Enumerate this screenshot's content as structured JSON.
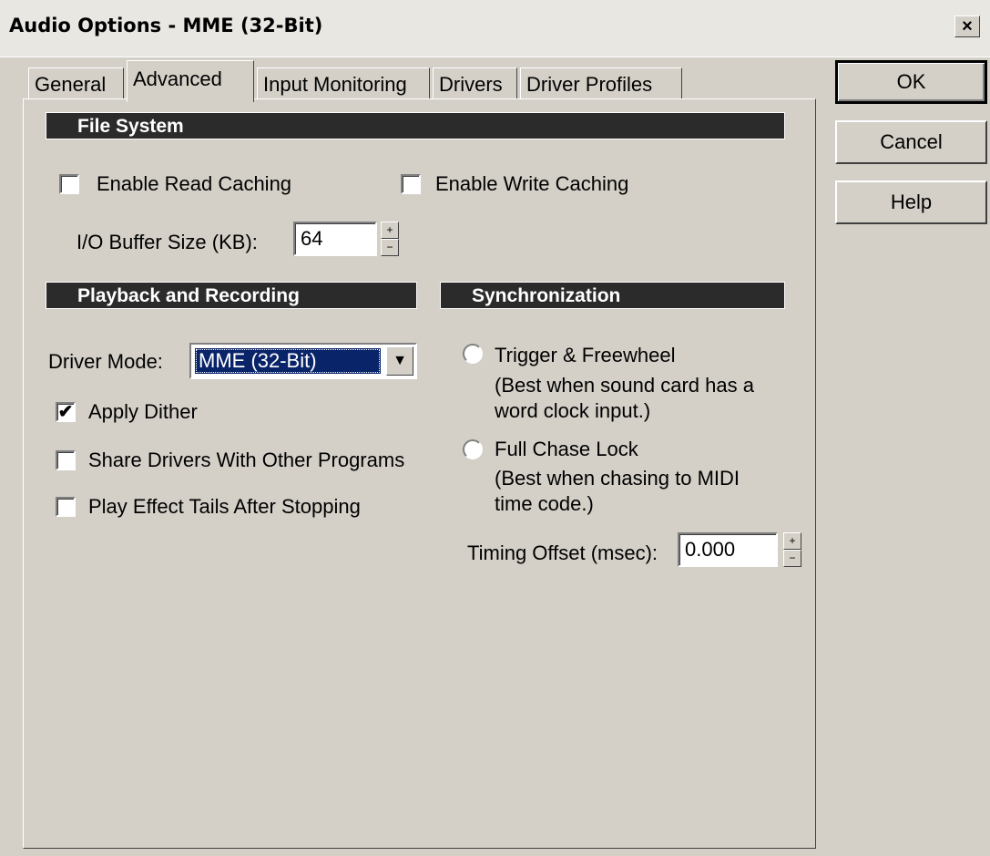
{
  "window": {
    "title": "Audio Options - MME (32-Bit)",
    "close_glyph": "×"
  },
  "tabs": [
    {
      "label": "General",
      "active": false
    },
    {
      "label": "Advanced",
      "active": true
    },
    {
      "label": "Input Monitoring",
      "active": false
    },
    {
      "label": "Drivers",
      "active": false
    },
    {
      "label": "Driver Profiles",
      "active": false
    }
  ],
  "file_system": {
    "heading": "File System",
    "read_caching": {
      "label": "Enable Read Caching",
      "checked": false
    },
    "write_caching": {
      "label": "Enable Write Caching",
      "checked": false
    },
    "buffer": {
      "label": "I/O Buffer Size (KB):",
      "value": "64"
    }
  },
  "playback": {
    "heading": "Playback and Recording",
    "driver_mode": {
      "label": "Driver Mode:",
      "value": "MME (32-Bit)"
    },
    "apply_dither": {
      "label": "Apply Dither",
      "checked": true
    },
    "share_drivers": {
      "label": "Share Drivers With Other Programs",
      "checked": false
    },
    "effect_tails": {
      "label": "Play Effect Tails After Stopping",
      "checked": false
    }
  },
  "sync": {
    "heading": "Synchronization",
    "trigger": {
      "label": "Trigger & Freewheel",
      "desc1": "(Best when sound card has a",
      "desc2": "word clock input.)",
      "selected": false
    },
    "chase": {
      "label": "Full Chase Lock",
      "desc1": "(Best when chasing to MIDI",
      "desc2": "time code.)",
      "selected": false
    },
    "timing_offset": {
      "label": "Timing Offset (msec):",
      "value": "0.000"
    }
  },
  "buttons": {
    "ok": "OK",
    "cancel": "Cancel",
    "help": "Help"
  },
  "check_glyph": "✔",
  "dropdown_glyph": "▼",
  "spin_up": "+",
  "spin_down": "−"
}
